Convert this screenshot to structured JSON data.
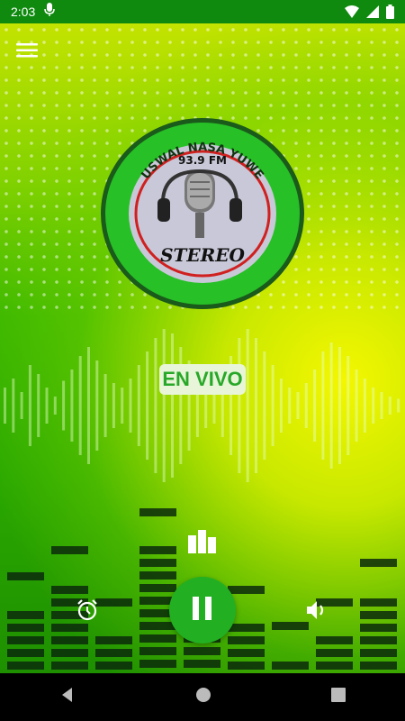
{
  "status_bar": {
    "time": "2:03"
  },
  "station": {
    "name": "USWAL NASA YUWE",
    "frequency": "93.9 FM",
    "subtitle": "STEREO"
  },
  "player": {
    "live_label": "EN VIVO",
    "state": "playing"
  },
  "icons": {
    "menu": "menu-icon",
    "alarm": "alarm-icon",
    "play_pause": "pause-icon",
    "volume": "volume-icon",
    "equalizer": "equalizer-icon"
  },
  "colors": {
    "accent": "#22b022",
    "status_bar": "#0f8a0f"
  }
}
